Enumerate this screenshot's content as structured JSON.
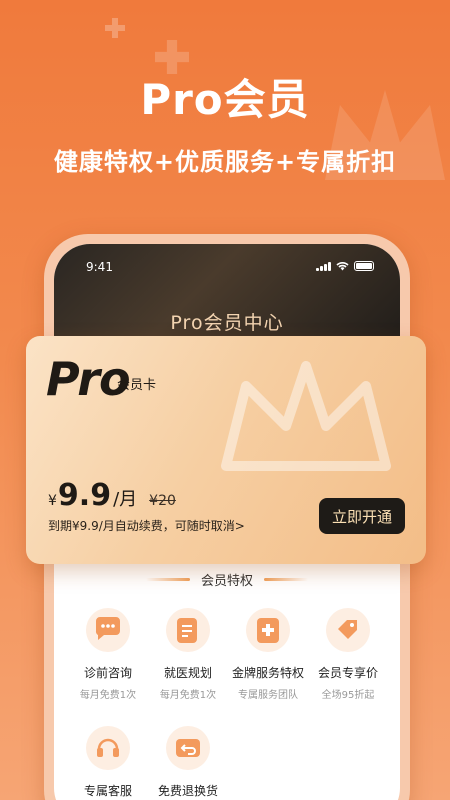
{
  "hero": {
    "title": "Pro会员",
    "subtitle": "健康特权+优质服务+专属折扣"
  },
  "status_bar": {
    "time": "9:41"
  },
  "screen": {
    "title": "Pro会员中心"
  },
  "card": {
    "logo": "Pro",
    "logo_suffix": "会员卡",
    "currency": "¥",
    "price": "9.9",
    "unit": "/月",
    "old_price": "¥20",
    "renew_note": "到期¥9.9/月自动续费，可随时取消>",
    "cta": "立即开通"
  },
  "benefits": {
    "title": "会员特权",
    "items": [
      {
        "label": "诊前咨询",
        "sub": "每月免费1次",
        "icon": "chat-bubble-icon"
      },
      {
        "label": "就医规划",
        "sub": "每月免费1次",
        "icon": "clipboard-icon"
      },
      {
        "label": "金牌服务特权",
        "sub": "专属服务团队",
        "icon": "medical-kit-icon"
      },
      {
        "label": "会员专享价",
        "sub": "全场95折起",
        "icon": "price-tag-icon"
      },
      {
        "label": "专属客服",
        "sub": "",
        "icon": "headset-icon"
      },
      {
        "label": "免费退换货",
        "sub": "",
        "icon": "return-wallet-icon"
      }
    ]
  },
  "colors": {
    "brand_orange": "#f07a3c",
    "accent_orange": "#f39a5d",
    "gold_text": "#f3d4b1",
    "button_dark": "#1e1b17"
  }
}
